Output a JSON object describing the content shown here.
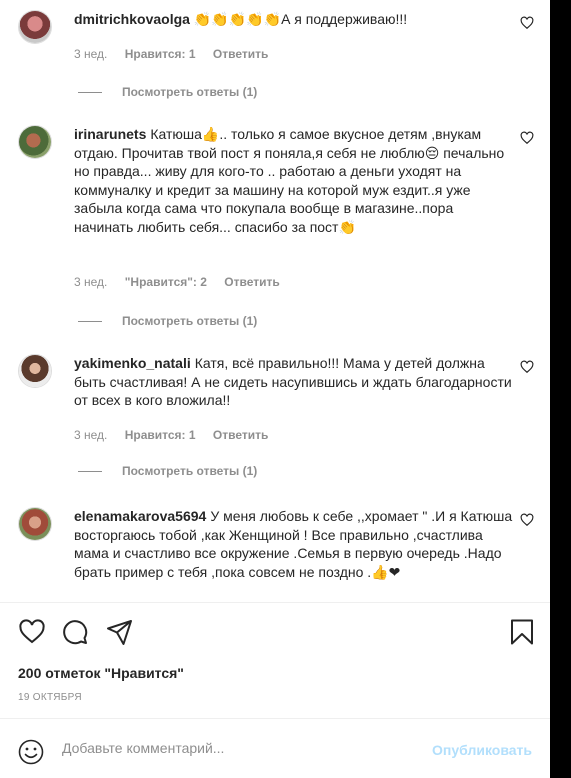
{
  "comments": [
    {
      "username": "dmitrichkovaolga",
      "text": "👏👏👏👏👏А я поддерживаю!!!",
      "time": "3 нед.",
      "likes": "Нравится: 1",
      "reply": "Ответить",
      "view_replies": "Посмотреть ответы (1)"
    },
    {
      "username": "irinarunets",
      "text": "Катюша👍.. только я самое вкусное детям ,внукам отдаю. Прочитав твой пост я поняла,я себя не люблю😔 печально но правда... живу для кого-то .. работаю а деньги уходят на коммуналку и кредит за машину на которой муж ездит..я уже забыла когда сама что покупала вообще в магазине..пора начинать любить себя... спасибо за пост👏",
      "time": "3 нед.",
      "likes": "\"Нравится\": 2",
      "reply": "Ответить",
      "view_replies": "Посмотреть ответы (1)"
    },
    {
      "username": "yakimenko_natali",
      "text": "Катя, всё правильно!!! Мама у детей должна быть счастливая! А не сидеть насупившись и ждать благодарности от всех в кого вложила!!",
      "time": "3 нед.",
      "likes": "Нравится: 1",
      "reply": "Ответить",
      "view_replies": "Посмотреть ответы (1)"
    },
    {
      "username": "elenamakarova5694",
      "text": "У меня любовь к себе ,,хромает \" .И я Катюша восторгаюсь тобой ,как Женщиной ! Все правильно ,счастлива мама и счастливо все окружение .Семья в первую очередь .Надо брать пример с тебя ,пока совсем не поздно .👍❤",
      "time": "",
      "likes": "",
      "reply": "",
      "view_replies": ""
    }
  ],
  "post": {
    "likes_count": "200 отметок \"Нравится\"",
    "date": "19 ОКТЯБРЯ"
  },
  "comment_box": {
    "placeholder": "Добавьте комментарий...",
    "publish_label": "Опубликовать"
  },
  "icons": {
    "like": "heart-icon",
    "comment": "speech-bubble-icon",
    "share": "paper-plane-icon",
    "save": "bookmark-icon",
    "emoji": "smiley-icon"
  },
  "colors": {
    "publish_disabled": "#b2dffc",
    "muted_text": "#8e8e8e"
  }
}
